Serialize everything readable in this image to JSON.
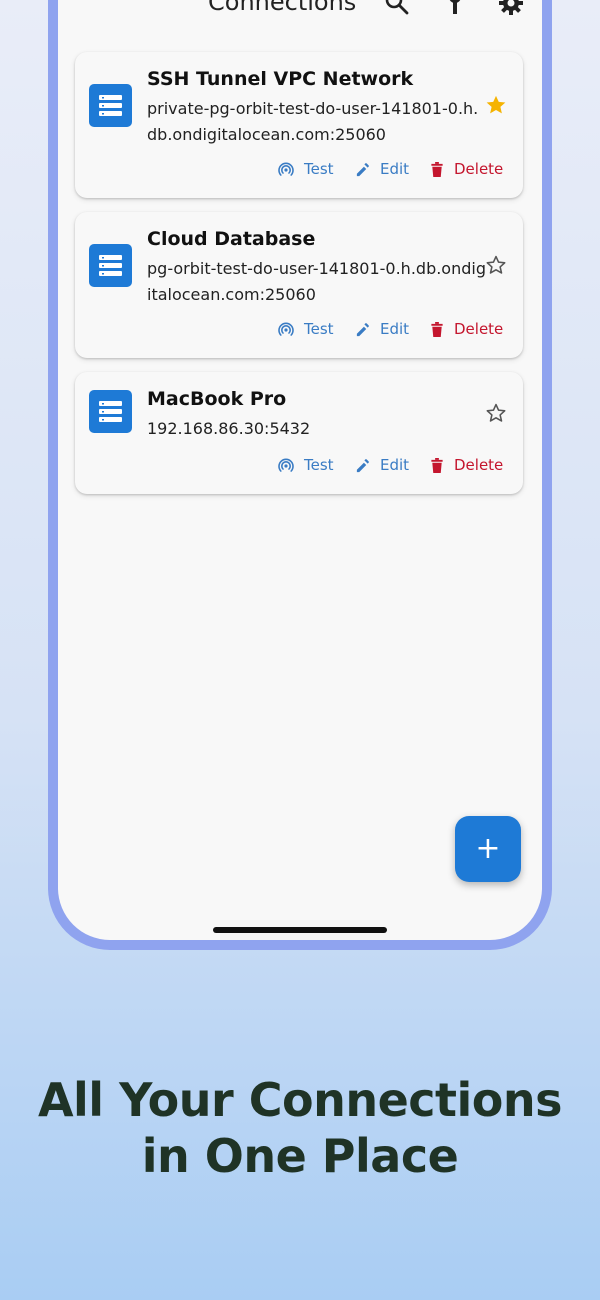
{
  "appbar": {
    "title": "Connections",
    "icons": [
      "search-icon",
      "key-icon",
      "gear-icon"
    ]
  },
  "connections": [
    {
      "name": "SSH Tunnel VPC Network",
      "address": "private-pg-orbit-test-do-user-141801-0.h.db.ondigitalocean.com:25060",
      "starred": true
    },
    {
      "name": "Cloud Database",
      "address": "pg-orbit-test-do-user-141801-0.h.db.ondigitalocean.com:25060",
      "starred": false
    },
    {
      "name": "MacBook Pro",
      "address": "192.168.86.30:5432",
      "starred": false
    }
  ],
  "actions": {
    "test_label": "Test",
    "edit_label": "Edit",
    "delete_label": "Delete"
  },
  "fab": {
    "label": "+"
  },
  "tagline": {
    "line1": "All Your Connections",
    "line2": "in One Place"
  },
  "colors": {
    "accent": "#1e7ad6",
    "action_blue": "#3a7cc4",
    "delete_red": "#c4162e",
    "star_gold": "#f5b301",
    "phone_frame": "#8fa3ef",
    "tagline": "#1f3326"
  }
}
